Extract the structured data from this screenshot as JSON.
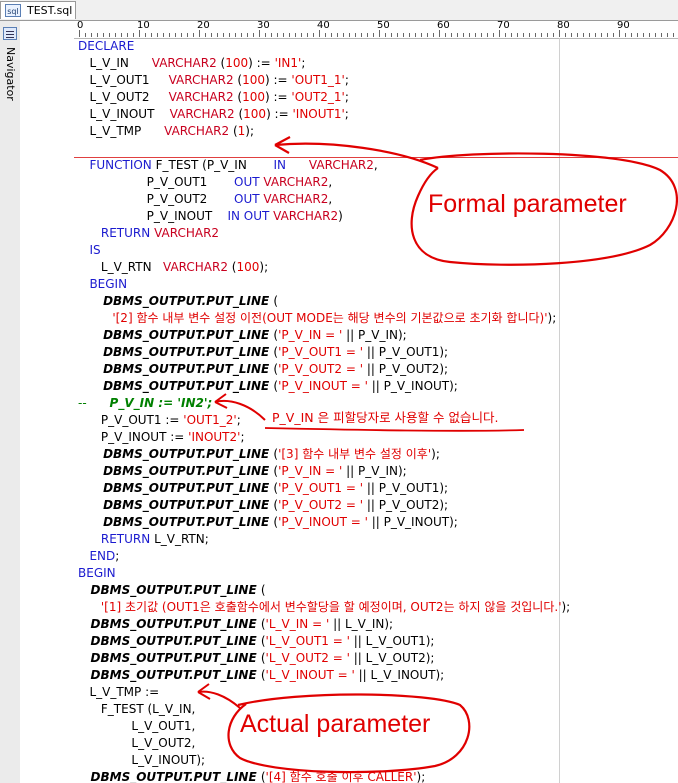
{
  "tab": {
    "label": "TEST.sql",
    "icon": "sql-file-icon"
  },
  "navigator": {
    "label": "Navigator",
    "icon": "navigator-icon"
  },
  "ruler": {
    "labels": [
      "0",
      "10",
      "20",
      "30",
      "40",
      "50",
      "60",
      "70",
      "80",
      "90"
    ]
  },
  "lines": [
    {
      "n": "4",
      "segs": [
        {
          "c": "k",
          "t": "DECLARE"
        }
      ]
    },
    {
      "n": "5",
      "segs": [
        {
          "c": "n",
          "t": "   L_V_IN      "
        },
        {
          "c": "t",
          "t": "VARCHAR2 "
        },
        {
          "c": "n",
          "t": "("
        },
        {
          "c": "s",
          "t": "100"
        },
        {
          "c": "n",
          "t": ") := "
        },
        {
          "c": "s",
          "t": "'IN1'"
        },
        {
          "c": "n",
          "t": ";"
        }
      ]
    },
    {
      "n": "6",
      "segs": [
        {
          "c": "n",
          "t": "   L_V_OUT1     "
        },
        {
          "c": "t",
          "t": "VARCHAR2 "
        },
        {
          "c": "n",
          "t": "("
        },
        {
          "c": "s",
          "t": "100"
        },
        {
          "c": "n",
          "t": ") := "
        },
        {
          "c": "s",
          "t": "'OUT1_1'"
        },
        {
          "c": "n",
          "t": ";"
        }
      ]
    },
    {
      "n": "7",
      "segs": [
        {
          "c": "n",
          "t": "   L_V_OUT2     "
        },
        {
          "c": "t",
          "t": "VARCHAR2 "
        },
        {
          "c": "n",
          "t": "("
        },
        {
          "c": "s",
          "t": "100"
        },
        {
          "c": "n",
          "t": ") := "
        },
        {
          "c": "s",
          "t": "'OUT2_1'"
        },
        {
          "c": "n",
          "t": ";"
        }
      ]
    },
    {
      "n": "8",
      "segs": [
        {
          "c": "n",
          "t": "   L_V_INOUT    "
        },
        {
          "c": "t",
          "t": "VARCHAR2 "
        },
        {
          "c": "n",
          "t": "("
        },
        {
          "c": "s",
          "t": "100"
        },
        {
          "c": "n",
          "t": ") := "
        },
        {
          "c": "s",
          "t": "'INOUT1'"
        },
        {
          "c": "n",
          "t": ";"
        }
      ]
    },
    {
      "n": "9",
      "segs": [
        {
          "c": "n",
          "t": "   L_V_TMP      "
        },
        {
          "c": "t",
          "t": "VARCHAR2 "
        },
        {
          "c": "n",
          "t": "("
        },
        {
          "c": "s",
          "t": "1"
        },
        {
          "c": "n",
          "t": ");"
        }
      ]
    },
    {
      "n": "10",
      "segs": []
    },
    {
      "n": "11",
      "segs": [
        {
          "c": "k",
          "t": "   FUNCTION "
        },
        {
          "c": "n",
          "t": "F_TEST (P_V_IN       "
        },
        {
          "c": "k",
          "t": "IN      "
        },
        {
          "c": "t",
          "t": "VARCHAR2"
        },
        {
          "c": "n",
          "t": ","
        }
      ]
    },
    {
      "n": "12",
      "segs": [
        {
          "c": "n",
          "t": "                  P_V_OUT1       "
        },
        {
          "c": "k",
          "t": "OUT "
        },
        {
          "c": "t",
          "t": "VARCHAR2"
        },
        {
          "c": "n",
          "t": ","
        }
      ]
    },
    {
      "n": "13",
      "segs": [
        {
          "c": "n",
          "t": "                  P_V_OUT2       "
        },
        {
          "c": "k",
          "t": "OUT "
        },
        {
          "c": "t",
          "t": "VARCHAR2"
        },
        {
          "c": "n",
          "t": ","
        }
      ]
    },
    {
      "n": "14",
      "segs": [
        {
          "c": "n",
          "t": "                  P_V_INOUT    "
        },
        {
          "c": "k",
          "t": "IN OUT "
        },
        {
          "c": "t",
          "t": "VARCHAR2"
        },
        {
          "c": "n",
          "t": ")"
        }
      ]
    },
    {
      "n": "15",
      "segs": [
        {
          "c": "k",
          "t": "      RETURN "
        },
        {
          "c": "t",
          "t": "VARCHAR2"
        }
      ]
    },
    {
      "n": "16",
      "segs": [
        {
          "c": "k",
          "t": "   IS"
        }
      ]
    },
    {
      "n": "17",
      "segs": [
        {
          "c": "n",
          "t": "      L_V_RTN   "
        },
        {
          "c": "t",
          "t": "VARCHAR2 "
        },
        {
          "c": "n",
          "t": "("
        },
        {
          "c": "s",
          "t": "100"
        },
        {
          "c": "n",
          "t": ");"
        }
      ]
    },
    {
      "n": "18",
      "segs": [
        {
          "c": "k",
          "t": "   BEGIN"
        }
      ]
    },
    {
      "n": "19",
      "segs": [
        {
          "c": "b",
          "t": "      DBMS_OUTPUT.PUT_LINE "
        },
        {
          "c": "n",
          "t": "("
        }
      ]
    },
    {
      "n": "20",
      "segs": [
        {
          "c": "s",
          "t": "         '[2] 함수 내부 변수 설정 이전(OUT MODE는 해당 변수의 기본값으로 초기화 합니다)'"
        },
        {
          "c": "n",
          "t": ");"
        }
      ]
    },
    {
      "n": "21",
      "segs": [
        {
          "c": "b",
          "t": "      DBMS_OUTPUT.PUT_LINE "
        },
        {
          "c": "n",
          "t": "("
        },
        {
          "c": "s",
          "t": "'P_V_IN = ' "
        },
        {
          "c": "n",
          "t": "|| P_V_IN);"
        }
      ]
    },
    {
      "n": "22",
      "segs": [
        {
          "c": "b",
          "t": "      DBMS_OUTPUT.PUT_LINE "
        },
        {
          "c": "n",
          "t": "("
        },
        {
          "c": "s",
          "t": "'P_V_OUT1 = ' "
        },
        {
          "c": "n",
          "t": "|| P_V_OUT1);"
        }
      ]
    },
    {
      "n": "23",
      "segs": [
        {
          "c": "b",
          "t": "      DBMS_OUTPUT.PUT_LINE "
        },
        {
          "c": "n",
          "t": "("
        },
        {
          "c": "s",
          "t": "'P_V_OUT2 = ' "
        },
        {
          "c": "n",
          "t": "|| P_V_OUT2);"
        }
      ]
    },
    {
      "n": "24",
      "segs": [
        {
          "c": "b",
          "t": "      DBMS_OUTPUT.PUT_LINE "
        },
        {
          "c": "n",
          "t": "("
        },
        {
          "c": "s",
          "t": "'P_V_INOUT = ' "
        },
        {
          "c": "n",
          "t": "|| P_V_INOUT);"
        }
      ]
    },
    {
      "n": "25",
      "segs": [
        {
          "c": "cm",
          "t": "--      "
        },
        {
          "c": "ci",
          "t": "P_V_IN := 'IN2';"
        }
      ]
    },
    {
      "n": "26",
      "segs": [
        {
          "c": "n",
          "t": "      P_V_OUT1 := "
        },
        {
          "c": "s",
          "t": "'OUT1_2'"
        },
        {
          "c": "n",
          "t": ";"
        }
      ]
    },
    {
      "n": "27",
      "segs": [
        {
          "c": "n",
          "t": "      P_V_INOUT := "
        },
        {
          "c": "s",
          "t": "'INOUT2'"
        },
        {
          "c": "n",
          "t": ";"
        }
      ]
    },
    {
      "n": "28",
      "segs": [
        {
          "c": "b",
          "t": "      DBMS_OUTPUT.PUT_LINE "
        },
        {
          "c": "n",
          "t": "("
        },
        {
          "c": "s",
          "t": "'[3] 함수 내부 변수 설정 이후'"
        },
        {
          "c": "n",
          "t": ");"
        }
      ]
    },
    {
      "n": "29",
      "segs": [
        {
          "c": "b",
          "t": "      DBMS_OUTPUT.PUT_LINE "
        },
        {
          "c": "n",
          "t": "("
        },
        {
          "c": "s",
          "t": "'P_V_IN = ' "
        },
        {
          "c": "n",
          "t": "|| P_V_IN);"
        }
      ]
    },
    {
      "n": "30",
      "segs": [
        {
          "c": "b",
          "t": "      DBMS_OUTPUT.PUT_LINE "
        },
        {
          "c": "n",
          "t": "("
        },
        {
          "c": "s",
          "t": "'P_V_OUT1 = ' "
        },
        {
          "c": "n",
          "t": "|| P_V_OUT1);"
        }
      ]
    },
    {
      "n": "31",
      "segs": [
        {
          "c": "b",
          "t": "      DBMS_OUTPUT.PUT_LINE "
        },
        {
          "c": "n",
          "t": "("
        },
        {
          "c": "s",
          "t": "'P_V_OUT2 = ' "
        },
        {
          "c": "n",
          "t": "|| P_V_OUT2);"
        }
      ]
    },
    {
      "n": "32",
      "segs": [
        {
          "c": "b",
          "t": "      DBMS_OUTPUT.PUT_LINE "
        },
        {
          "c": "n",
          "t": "("
        },
        {
          "c": "s",
          "t": "'P_V_INOUT = ' "
        },
        {
          "c": "n",
          "t": "|| P_V_INOUT);"
        }
      ]
    },
    {
      "n": "33",
      "segs": [
        {
          "c": "k",
          "t": "      RETURN "
        },
        {
          "c": "n",
          "t": "L_V_RTN;"
        }
      ]
    },
    {
      "n": "34",
      "segs": [
        {
          "c": "k",
          "t": "   END"
        },
        {
          "c": "n",
          "t": ";"
        }
      ]
    },
    {
      "n": "35",
      "segs": [
        {
          "c": "k",
          "t": "BEGIN"
        }
      ]
    },
    {
      "n": "36",
      "segs": [
        {
          "c": "b",
          "t": "   DBMS_OUTPUT.PUT_LINE "
        },
        {
          "c": "n",
          "t": "("
        }
      ]
    },
    {
      "n": "37",
      "segs": [
        {
          "c": "s",
          "t": "      '[1] 초기값 (OUT1은 호출함수에서 변수할당을 할 예정이며, OUT2는 하지 않을 것입니다.'"
        },
        {
          "c": "n",
          "t": ");"
        }
      ]
    },
    {
      "n": "38",
      "segs": [
        {
          "c": "b",
          "t": "   DBMS_OUTPUT.PUT_LINE "
        },
        {
          "c": "n",
          "t": "("
        },
        {
          "c": "s",
          "t": "'L_V_IN = ' "
        },
        {
          "c": "n",
          "t": "|| L_V_IN);"
        }
      ]
    },
    {
      "n": "39",
      "segs": [
        {
          "c": "b",
          "t": "   DBMS_OUTPUT.PUT_LINE "
        },
        {
          "c": "n",
          "t": "("
        },
        {
          "c": "s",
          "t": "'L_V_OUT1 = ' "
        },
        {
          "c": "n",
          "t": "|| L_V_OUT1);"
        }
      ]
    },
    {
      "n": "40",
      "segs": [
        {
          "c": "b",
          "t": "   DBMS_OUTPUT.PUT_LINE "
        },
        {
          "c": "n",
          "t": "("
        },
        {
          "c": "s",
          "t": "'L_V_OUT2 = ' "
        },
        {
          "c": "n",
          "t": "|| L_V_OUT2);"
        }
      ]
    },
    {
      "n": "41",
      "segs": [
        {
          "c": "b",
          "t": "   DBMS_OUTPUT.PUT_LINE "
        },
        {
          "c": "n",
          "t": "("
        },
        {
          "c": "s",
          "t": "'L_V_INOUT = ' "
        },
        {
          "c": "n",
          "t": "|| L_V_INOUT);"
        }
      ]
    },
    {
      "n": "42",
      "segs": [
        {
          "c": "n",
          "t": "   L_V_TMP :="
        }
      ]
    },
    {
      "n": "43",
      "segs": [
        {
          "c": "n",
          "t": "      F_TEST (L_V_IN,"
        }
      ]
    },
    {
      "n": "44",
      "segs": [
        {
          "c": "n",
          "t": "              L_V_OUT1,"
        }
      ]
    },
    {
      "n": "45",
      "segs": [
        {
          "c": "n",
          "t": "              L_V_OUT2,"
        }
      ]
    },
    {
      "n": "46",
      "segs": [
        {
          "c": "n",
          "t": "              L_V_INOUT);"
        }
      ]
    },
    {
      "n": "47",
      "segs": [
        {
          "c": "b",
          "t": "   DBMS_OUTPUT.PUT_LINE "
        },
        {
          "c": "n",
          "t": "("
        },
        {
          "c": "s",
          "t": "'[4] 함수 호출 이후 CALLER'"
        },
        {
          "c": "n",
          "t": ");"
        }
      ]
    }
  ],
  "annotations": {
    "formal": "Formal parameter",
    "actual": "Actual parameter",
    "note": "P_V_IN 은 피할당자로 사용할 수 없습니다."
  }
}
